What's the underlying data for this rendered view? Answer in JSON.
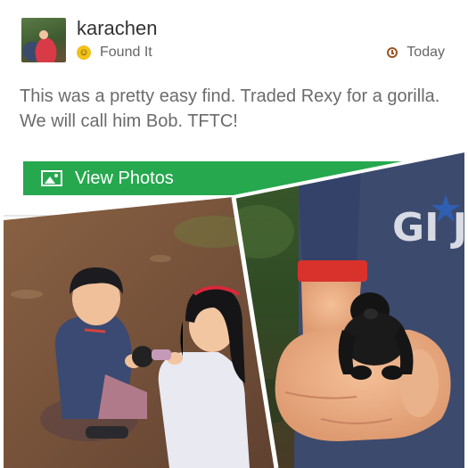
{
  "log": {
    "username": "karachen",
    "log_type": "Found It",
    "log_icon": "smiley-icon",
    "date": "Today",
    "text": "This was a pretty easy find. Traded Rexy for a gorilla. We will call him Bob. TFTC!"
  },
  "photos_button": {
    "label": "View Photos",
    "icon": "image-icon",
    "color": "#26a84e"
  },
  "photos": {
    "shirt_text": "GI J"
  }
}
